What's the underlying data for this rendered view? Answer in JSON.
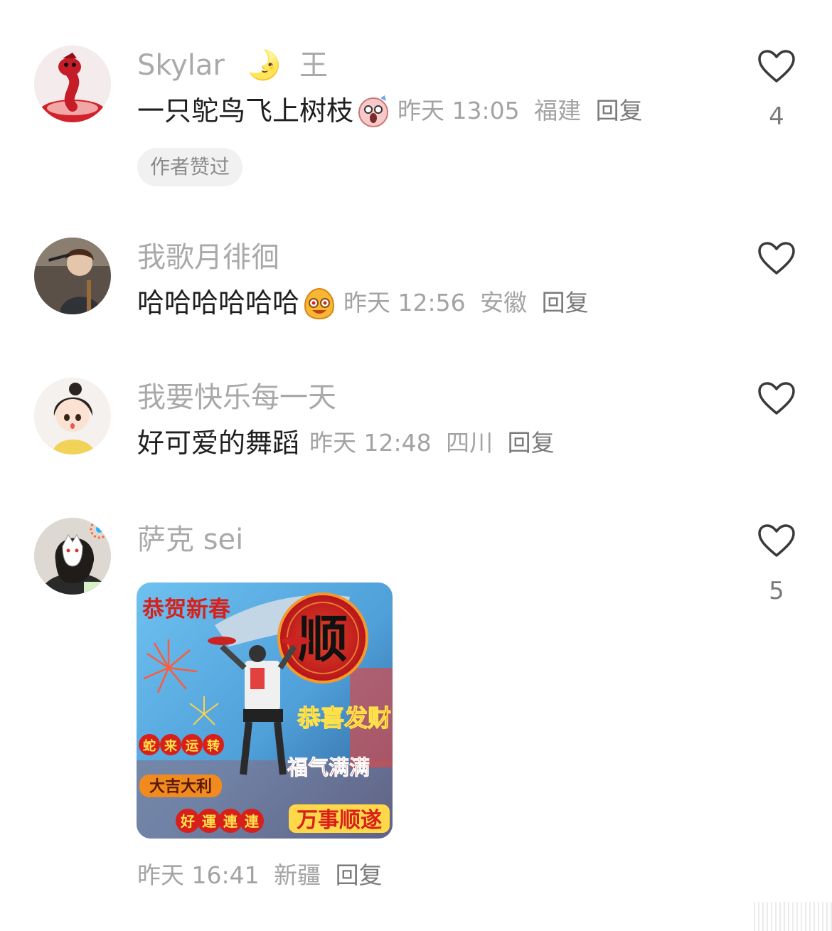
{
  "comments": [
    {
      "name": "Skylar",
      "name_decor": [
        "🌛",
        "王"
      ],
      "text": "一只鸵鸟飞上树枝",
      "emoji": "shocked-face-icon",
      "time": "昨天 13:05",
      "location": "福建",
      "reply": "回复",
      "likes": "4",
      "badge": "作者赞过"
    },
    {
      "name": "我歌月徘徊",
      "text": "哈哈哈哈哈哈",
      "emoji": "laughing-face-icon",
      "time": "昨天 12:56",
      "location": "安徽",
      "reply": "回复",
      "likes": ""
    },
    {
      "name": "我要快乐每一天",
      "text": "好可爱的舞蹈",
      "time": "昨天 12:48",
      "location": "四川",
      "reply": "回复",
      "likes": ""
    },
    {
      "name": "萨克 sei",
      "time": "昨天 16:41",
      "location": "新疆",
      "reply": "回复",
      "likes": "5",
      "image_text": {
        "top_left": "恭贺新春",
        "circle": "顺",
        "middle_right": "恭喜发财",
        "lanterns": [
          "蛇",
          "来",
          "运",
          "转"
        ],
        "blessing": "福气满满",
        "fortune": "大吉大利",
        "bottom_left": [
          "好",
          "運",
          "連",
          "連"
        ],
        "bottom_right": "万事顺遂"
      }
    }
  ],
  "colors": {
    "name": "#a9a9a9",
    "text": "#1f1f1f",
    "meta": "#a3a3a3",
    "badge_bg": "#f1f1f1",
    "poster_red": "#d8201b",
    "poster_blue": "#5fb0e8"
  }
}
